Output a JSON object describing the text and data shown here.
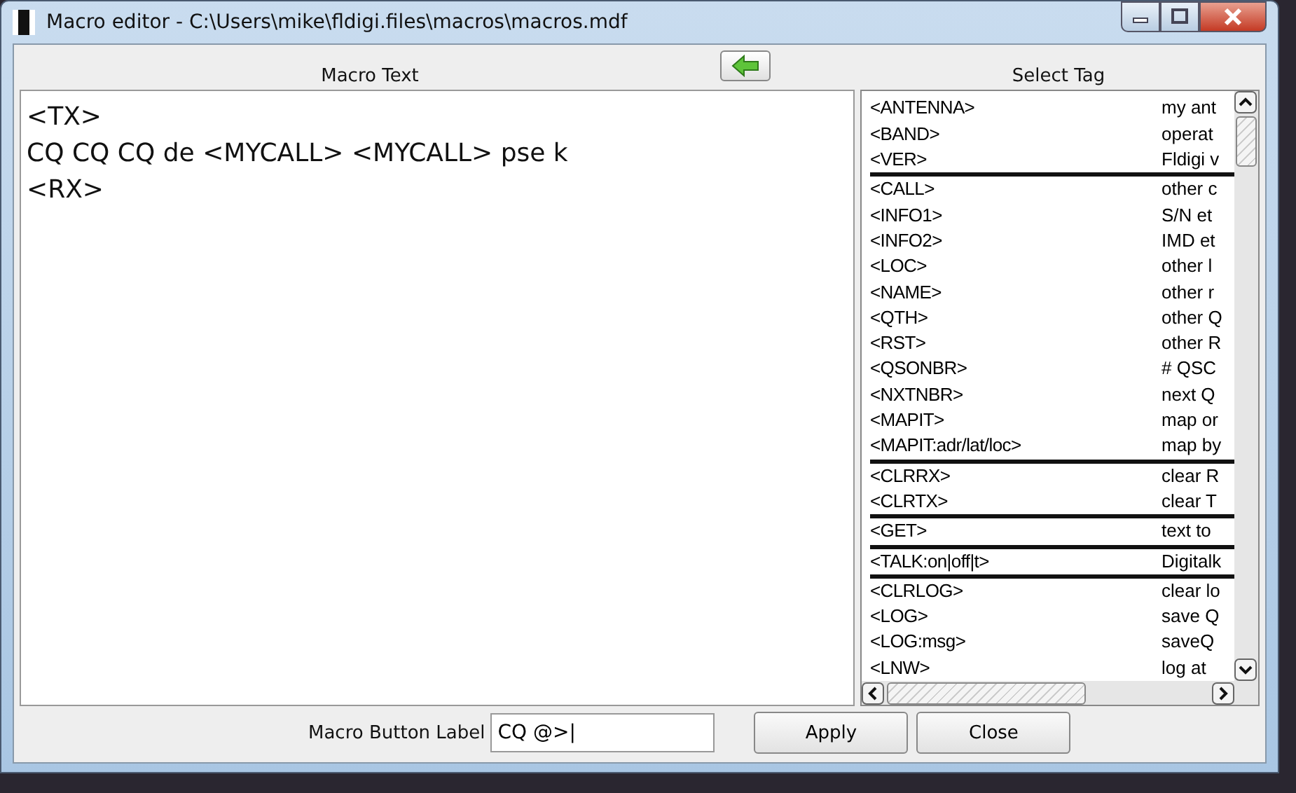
{
  "window": {
    "title": "Macro editor - C:\\Users\\mike\\fldigi.files\\macros\\macros.mdf"
  },
  "macro_text": {
    "heading": "Macro Text",
    "lines": [
      "<TX>",
      "CQ CQ CQ de <MYCALL> <MYCALL> pse k",
      "<RX>"
    ]
  },
  "select_tag": {
    "heading": "Select Tag",
    "groups": [
      {
        "rows": [
          {
            "tag": "<ANTENNA>",
            "description": "my ant"
          },
          {
            "tag": "<BAND>",
            "description": "operat"
          },
          {
            "tag": "<VER>",
            "description": "Fldigi v"
          }
        ]
      },
      {
        "rows": [
          {
            "tag": "<CALL>",
            "description": "other c"
          },
          {
            "tag": "<INFO1>",
            "description": "S/N et"
          },
          {
            "tag": "<INFO2>",
            "description": "IMD et"
          },
          {
            "tag": "<LOC>",
            "description": "other l"
          },
          {
            "tag": "<NAME>",
            "description": "other r"
          },
          {
            "tag": "<QTH>",
            "description": "other Q"
          },
          {
            "tag": "<RST>",
            "description": "other R"
          },
          {
            "tag": "<QSONBR>",
            "description": "# QSC"
          },
          {
            "tag": "<NXTNBR>",
            "description": "next Q"
          },
          {
            "tag": "<MAPIT>",
            "description": "map or"
          },
          {
            "tag": "<MAPIT:adr/lat/loc>",
            "description": "map by"
          }
        ]
      },
      {
        "rows": [
          {
            "tag": "<CLRRX>",
            "description": "clear R"
          },
          {
            "tag": "<CLRTX>",
            "description": "clear T"
          }
        ]
      },
      {
        "rows": [
          {
            "tag": "<GET>",
            "description": "text to"
          }
        ]
      },
      {
        "rows": [
          {
            "tag": "<TALK:on|off|t>",
            "description": "Digitalk"
          }
        ]
      },
      {
        "rows": [
          {
            "tag": "<CLRLOG>",
            "description": "clear lo"
          },
          {
            "tag": "<LOG>",
            "description": "save Q"
          },
          {
            "tag": "<LOG:msg>",
            "description": "saveQ"
          },
          {
            "tag": "<LNW>",
            "description": "log at"
          }
        ]
      }
    ]
  },
  "bottom": {
    "label": "Macro Button Label",
    "value": "CQ @>|",
    "buttons": [
      "Apply",
      "Close"
    ]
  }
}
